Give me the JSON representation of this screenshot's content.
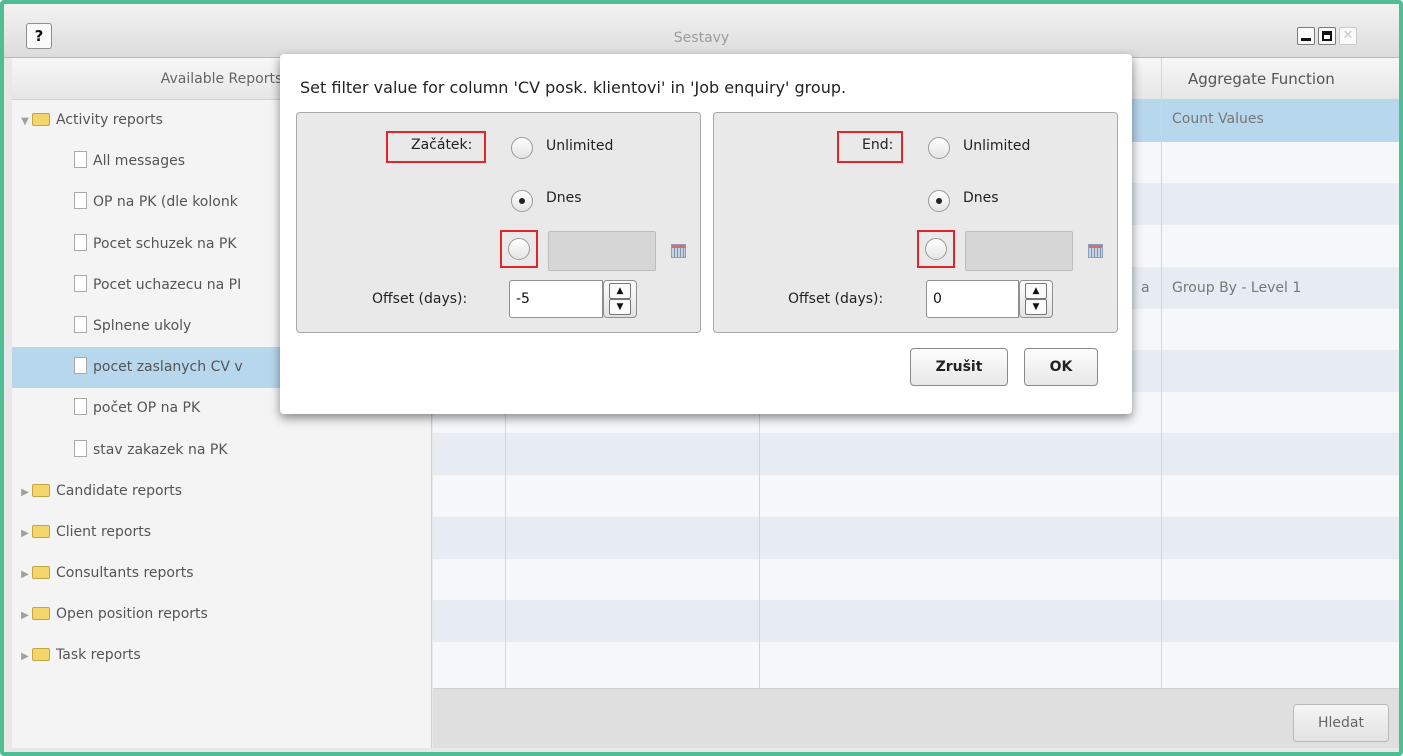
{
  "window": {
    "title": "Sestavy",
    "help_label": "?"
  },
  "left_pane": {
    "header": "Available Reports",
    "tree": [
      {
        "label": "Activity reports",
        "type": "folder",
        "expanded": true
      },
      {
        "label": "All messages",
        "type": "report"
      },
      {
        "label": "OP na PK (dle kolonk",
        "type": "report"
      },
      {
        "label": "Pocet schuzek na PK",
        "type": "report"
      },
      {
        "label": "Pocet uchazecu na PI",
        "type": "report"
      },
      {
        "label": "Splnene ukoly",
        "type": "report"
      },
      {
        "label": "pocet zaslanych CV v",
        "type": "report",
        "selected": true
      },
      {
        "label": "počet OP na PK",
        "type": "report"
      },
      {
        "label": "stav zakazek na PK",
        "type": "report"
      },
      {
        "label": "Candidate reports",
        "type": "folder",
        "expanded": false
      },
      {
        "label": "Client reports",
        "type": "folder",
        "expanded": false
      },
      {
        "label": "Consultants reports",
        "type": "folder",
        "expanded": false
      },
      {
        "label": "Open position reports",
        "type": "folder",
        "expanded": false
      },
      {
        "label": "Task reports",
        "type": "folder",
        "expanded": false
      }
    ]
  },
  "grid": {
    "aggregate_header": "Aggregate Function",
    "aggregate_values": [
      "Count Values",
      "Group By - Level 1"
    ],
    "partial_cell": "a"
  },
  "footer": {
    "search_button": "Hledat"
  },
  "dialog": {
    "title": "Set filter value for column 'CV posk. klientovi' in 'Job enquiry' group.",
    "start": {
      "label": "Začátek:",
      "unlimited": "Unlimited",
      "today": "Dnes",
      "selected_option": "Dnes",
      "offset_label": "Offset (days):",
      "offset_value": "-5",
      "date_value": ""
    },
    "end": {
      "label": "End:",
      "unlimited": "Unlimited",
      "today": "Dnes",
      "selected_option": "Dnes",
      "offset_label": "Offset (days):",
      "offset_value": "0",
      "date_value": ""
    },
    "cancel_button": "Zrušit",
    "ok_button": "OK"
  },
  "colors": {
    "window_border": "#4fbe95",
    "selection": "#b7d7ec",
    "annotation_red": "#e0262b",
    "folder": "#f3d56c"
  }
}
